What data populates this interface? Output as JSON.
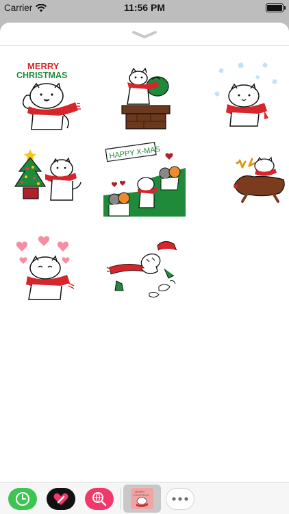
{
  "status_bar": {
    "carrier": "Carrier",
    "time": "11:56 PM",
    "battery_level": 1.0
  },
  "sticker_sheet": {
    "grabber_icon": "chevron-down-icon",
    "stickers": [
      {
        "id": "merry-christmas",
        "caption_line1": "MERRY",
        "caption_line2": "CHRISTMAS"
      },
      {
        "id": "gift-sack-chimney"
      },
      {
        "id": "snowing"
      },
      {
        "id": "christmas-tree"
      },
      {
        "id": "happy-xmas-couples",
        "banner": "HAPPY X-MAS"
      },
      {
        "id": "reindeer-ride"
      },
      {
        "id": "hearts-love"
      },
      {
        "id": "santa-hat-fall"
      }
    ]
  },
  "app_drawer": {
    "apps": [
      {
        "name": "recents",
        "icon": "clock-icon",
        "color": "#3cc552"
      },
      {
        "name": "digital-touch",
        "icon": "heart-hand-icon",
        "color": "#111111"
      },
      {
        "name": "images-search",
        "icon": "globe-search-icon",
        "color": "#f0386a"
      },
      {
        "name": "christmas-sticker-pack",
        "icon": "sticker-pack-icon",
        "selected": true
      },
      {
        "name": "more",
        "icon": "ellipsis-icon"
      }
    ]
  },
  "colors": {
    "scarf_red": "#d6252b",
    "tree_green": "#1f8a3a",
    "sheet_bg": "#ffffff",
    "backdrop": "#bdbdbd"
  }
}
